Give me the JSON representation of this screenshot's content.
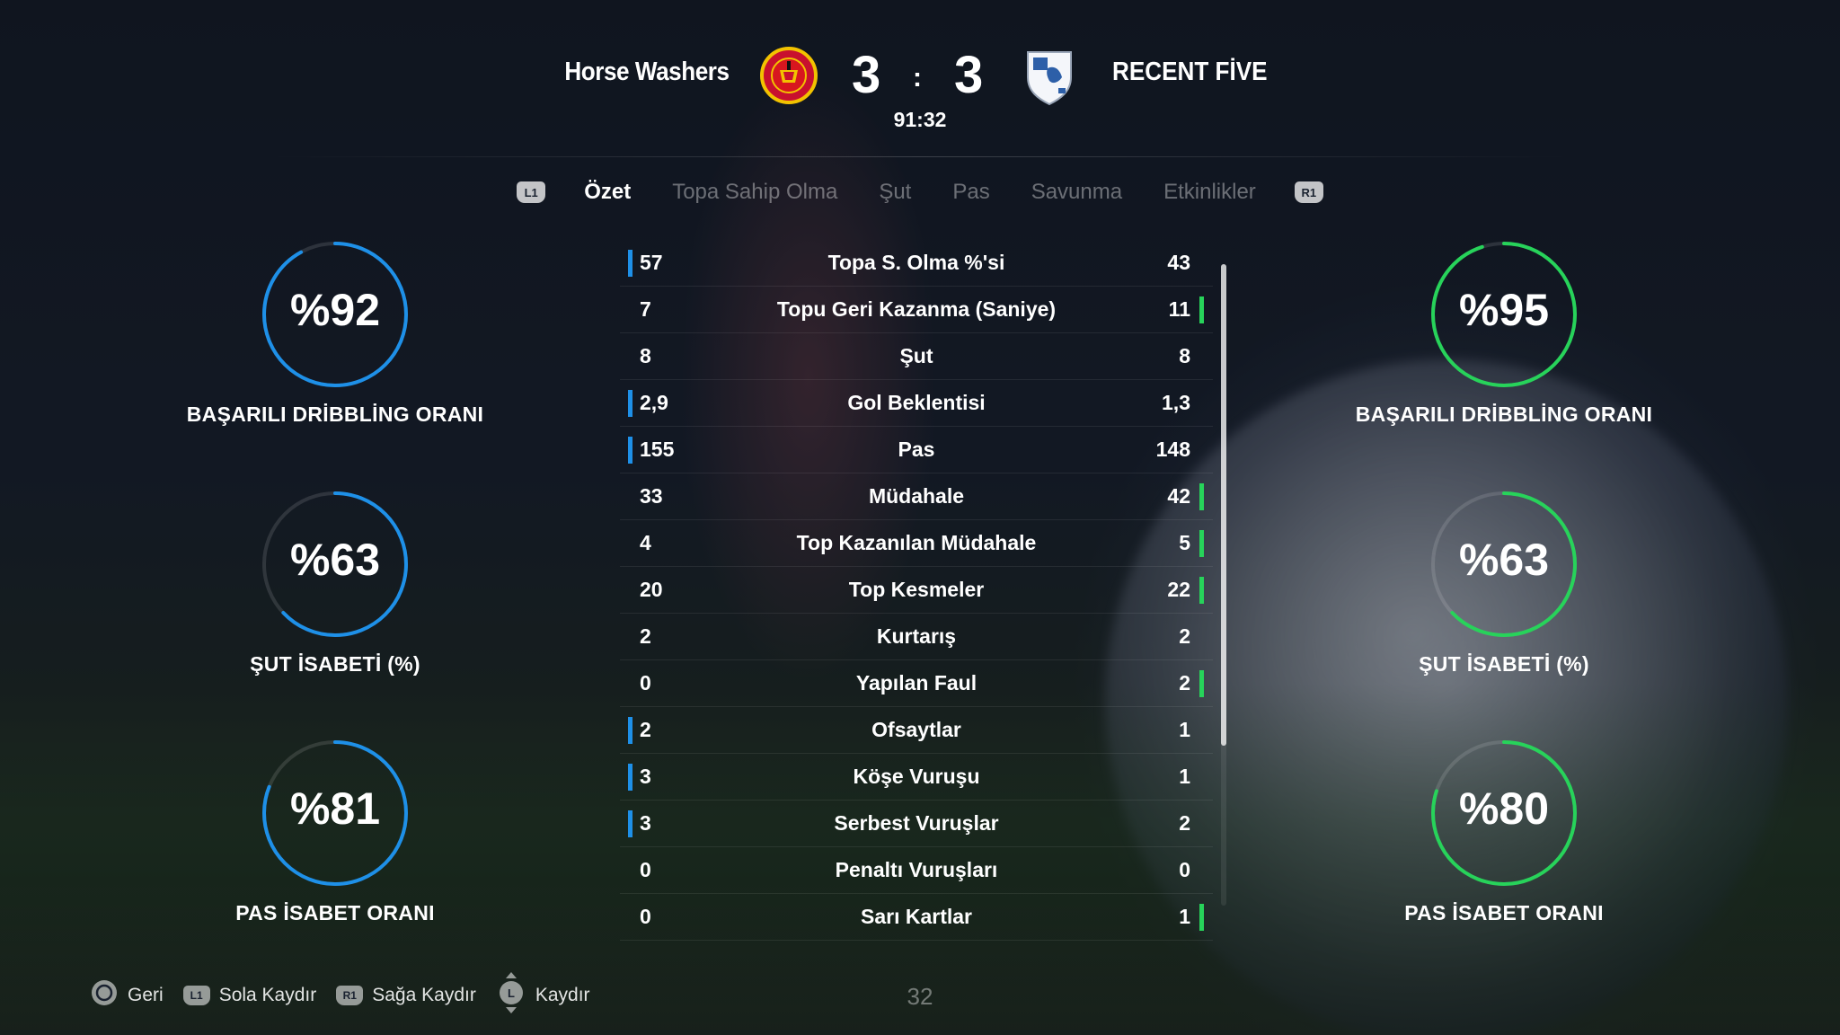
{
  "match": {
    "home_team": "Horse Washers",
    "away_team": "RECENT FİVE",
    "home_score": "3",
    "away_score": "3",
    "separator": ":",
    "clock": "91:32"
  },
  "tabs": {
    "left_button": "L1",
    "right_button": "R1",
    "items": [
      "Özet",
      "Topa Sahip Olma",
      "Şut",
      "Pas",
      "Savunma",
      "Etkinlikler"
    ],
    "active": "Özet"
  },
  "colors": {
    "home_bar": "#1e90e8",
    "away_bar": "#27d35a",
    "ring_home": "#1e90e8",
    "ring_away": "#27d35a"
  },
  "stats": [
    {
      "label": "Topa S. Olma %'si",
      "home": "57",
      "away": "43",
      "leader": "home"
    },
    {
      "label": "Topu Geri Kazanma (Saniye)",
      "home": "7",
      "away": "11",
      "leader": "away"
    },
    {
      "label": "Şut",
      "home": "8",
      "away": "8",
      "leader": "none"
    },
    {
      "label": "Gol Beklentisi",
      "home": "2,9",
      "away": "1,3",
      "leader": "home"
    },
    {
      "label": "Pas",
      "home": "155",
      "away": "148",
      "leader": "home"
    },
    {
      "label": "Müdahale",
      "home": "33",
      "away": "42",
      "leader": "away"
    },
    {
      "label": "Top Kazanılan Müdahale",
      "home": "4",
      "away": "5",
      "leader": "away"
    },
    {
      "label": "Top Kesmeler",
      "home": "20",
      "away": "22",
      "leader": "away"
    },
    {
      "label": "Kurtarış",
      "home": "2",
      "away": "2",
      "leader": "none"
    },
    {
      "label": "Yapılan Faul",
      "home": "0",
      "away": "2",
      "leader": "away"
    },
    {
      "label": "Ofsaytlar",
      "home": "2",
      "away": "1",
      "leader": "home"
    },
    {
      "label": "Köşe Vuruşu",
      "home": "3",
      "away": "1",
      "leader": "home"
    },
    {
      "label": "Serbest Vuruşlar",
      "home": "3",
      "away": "2",
      "leader": "home"
    },
    {
      "label": "Penaltı Vuruşları",
      "home": "0",
      "away": "0",
      "leader": "none"
    },
    {
      "label": "Sarı Kartlar",
      "home": "0",
      "away": "1",
      "leader": "away"
    }
  ],
  "home_rings": [
    {
      "value": "%92",
      "percent": 92,
      "label": "BAŞARILI DRİBBLİNG ORANI"
    },
    {
      "value": "%63",
      "percent": 63,
      "label": "ŞUT İSABETİ (%)"
    },
    {
      "value": "%81",
      "percent": 81,
      "label": "PAS İSABET ORANI"
    }
  ],
  "away_rings": [
    {
      "value": "%95",
      "percent": 95,
      "label": "BAŞARILI DRİBBLİNG ORANI"
    },
    {
      "value": "%63",
      "percent": 63,
      "label": "ŞUT İSABETİ (%)"
    },
    {
      "value": "%80",
      "percent": 80,
      "label": "PAS İSABET ORANI"
    }
  ],
  "scroll": {
    "visible_fraction": 0.75
  },
  "footer": {
    "back": {
      "icon": "circle-button-icon",
      "label": "Geri"
    },
    "left": {
      "icon": "L1",
      "label": "Sola Kaydır"
    },
    "right": {
      "icon": "R1",
      "label": "Sağa Kaydır"
    },
    "scroll": {
      "icon": "L",
      "label": "Kaydır"
    },
    "page_number": "32"
  }
}
